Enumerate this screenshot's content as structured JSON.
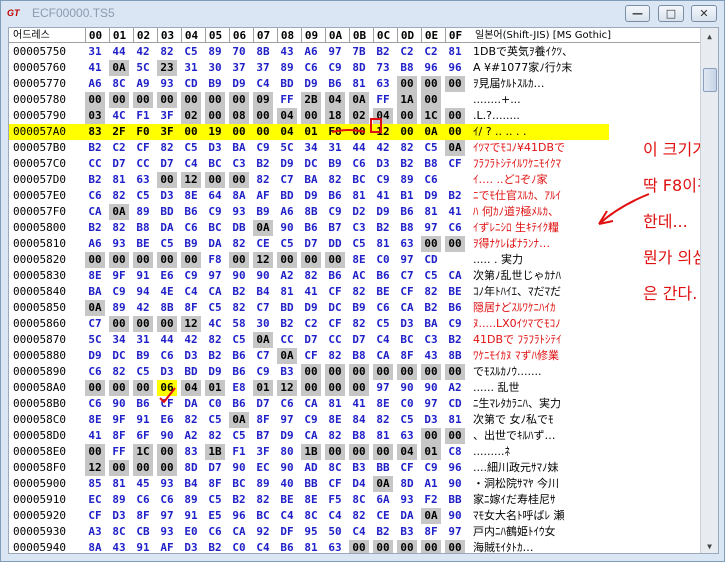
{
  "window": {
    "title": "ECF00000.TS5",
    "app_icon": "GT",
    "minimize_label": "—",
    "maximize_label": "□",
    "close_label": "✕"
  },
  "header": {
    "address_label": "어드레스",
    "columns": [
      "00",
      "01",
      "02",
      "03",
      "04",
      "05",
      "06",
      "07",
      "08",
      "09",
      "0A",
      "0B",
      "0C",
      "0D",
      "0E",
      "0F"
    ],
    "text_label": "일본어(Shift-JIS) [MS Gothic]"
  },
  "rows": [
    {
      "addr": "00005750",
      "bytes": [
        "31",
        "44",
        "42",
        "82",
        "C5",
        "89",
        "70",
        "8B",
        "43",
        "A6",
        "97",
        "7B",
        "B2",
        "C2",
        "C2",
        "81"
      ],
      "text": "1DBで英気ｦ養ｲｸﾂ、"
    },
    {
      "addr": "00005760",
      "bytes": [
        "41",
        "0A",
        "5C",
        "23",
        "31",
        "30",
        "37",
        "37",
        "89",
        "C6",
        "C9",
        "8D",
        "73",
        "B8",
        "96",
        "96"
      ],
      "text": "A ¥#1077家ﾉ行ｸ末"
    },
    {
      "addr": "00005770",
      "bytes": [
        "A6",
        "8C",
        "A9",
        "93",
        "CD",
        "B9",
        "D9",
        "C4",
        "BD",
        "D9",
        "B6",
        "81",
        "63",
        "00",
        "00",
        "00"
      ],
      "text": "ｦ見届ｹﾙﾄｽﾙｶ…"
    },
    {
      "addr": "00005780",
      "bytes": [
        "00",
        "00",
        "00",
        "00",
        "00",
        "00",
        "00",
        "09",
        "FF",
        "2B",
        "04",
        "0A",
        "FF",
        "1A",
        "00"
      ],
      "text": "........+..."
    },
    {
      "addr": "00005790",
      "bytes": [
        "03",
        "4C",
        "F1",
        "3F",
        "02",
        "00",
        "08",
        "00",
        "04",
        "00",
        "18",
        "02",
        "04",
        "00",
        "1C",
        "00"
      ],
      "text": ".L.?........"
    },
    {
      "addr": "000057A0",
      "bytes": [
        "83",
        "2F",
        "F0",
        "3F",
        "00",
        "19",
        "00",
        "00",
        "04",
        "01",
        "F8",
        "00",
        "12",
        "00",
        "0A",
        "00"
      ],
      "text": "ｲ/ ? .. .. . ."
    },
    {
      "addr": "000057B0",
      "bytes": [
        "B2",
        "C2",
        "CF",
        "82",
        "C5",
        "D3",
        "BA",
        "C9",
        "5C",
        "34",
        "31",
        "44",
        "42",
        "82",
        "C5",
        "0A"
      ],
      "text": "ｲﾂﾏでﾓｺﾉ¥41DBで"
    },
    {
      "addr": "000057C0",
      "bytes": [
        "CC",
        "D7",
        "CC",
        "D7",
        "C4",
        "BC",
        "C3",
        "B2",
        "D9",
        "DC",
        "B9",
        "C6",
        "D3",
        "B2",
        "B8",
        "CF"
      ],
      "text": "ﾌﾗﾌﾗﾄｼﾃｲﾙﾜｹﾆﾓｲｸﾏ"
    },
    {
      "addr": "000057D0",
      "bytes": [
        "B2",
        "81",
        "63",
        "00",
        "12",
        "00",
        "00",
        "82",
        "C7",
        "BA",
        "82",
        "BC",
        "C9",
        "89",
        "C6"
      ],
      "text": "ｲ…. ..どｺぞﾉ家"
    },
    {
      "addr": "000057E0",
      "bytes": [
        "C6",
        "82",
        "C5",
        "D3",
        "8E",
        "64",
        "8A",
        "AF",
        "BD",
        "D9",
        "B6",
        "81",
        "41",
        "B1",
        "D9",
        "B2"
      ],
      "text": "ﾆでﾓ仕官ｽﾙｶ、ｱﾙｲ"
    },
    {
      "addr": "000057F0",
      "bytes": [
        "CA",
        "0A",
        "89",
        "BD",
        "B6",
        "C9",
        "93",
        "B9",
        "A6",
        "8B",
        "C9",
        "D2",
        "D9",
        "B6",
        "81",
        "41"
      ],
      "text": "ﾊ 何ｶﾉ道ｦ極ﾒﾙｶ、"
    },
    {
      "addr": "00005800",
      "bytes": [
        "B2",
        "82",
        "B8",
        "DA",
        "C6",
        "BC",
        "DB",
        "0A",
        "90",
        "B6",
        "B7",
        "C3",
        "B2",
        "B8",
        "97",
        "C6"
      ],
      "text": "ｲずﾚﾆｼﾛ 生ｷﾃｲｸ糧"
    },
    {
      "addr": "00005810",
      "bytes": [
        "A6",
        "93",
        "BE",
        "C5",
        "B9",
        "DA",
        "82",
        "CE",
        "C5",
        "D7",
        "DD",
        "C5",
        "81",
        "63",
        "00",
        "00"
      ],
      "text": "ｦ得ﾅｹﾚばﾅﾗﾝﾅ…"
    },
    {
      "addr": "00005820",
      "bytes": [
        "00",
        "00",
        "00",
        "00",
        "00",
        "F8",
        "00",
        "12",
        "00",
        "00",
        "00",
        "8E",
        "C0",
        "97",
        "CD"
      ],
      "text": "..... . 実力"
    },
    {
      "addr": "00005830",
      "bytes": [
        "8E",
        "9F",
        "91",
        "E6",
        "C9",
        "97",
        "90",
        "90",
        "A2",
        "82",
        "B6",
        "AC",
        "B6",
        "C7",
        "C5",
        "CA"
      ],
      "text": "次第ﾉ乱世じゃｶﾅﾊ"
    },
    {
      "addr": "00005840",
      "bytes": [
        "BA",
        "C9",
        "94",
        "4E",
        "C4",
        "CA",
        "B2",
        "B4",
        "81",
        "41",
        "CF",
        "82",
        "BE",
        "CF",
        "82",
        "BE"
      ],
      "text": "ｺﾉ年ﾄﾊｲｴ、ﾏだﾏだ"
    },
    {
      "addr": "00005850",
      "bytes": [
        "0A",
        "89",
        "42",
        "8B",
        "8F",
        "C5",
        "82",
        "C7",
        "BD",
        "D9",
        "DC",
        "B9",
        "C6",
        "CA",
        "B2",
        "B6"
      ],
      "text": " 隠居ﾅどｽﾙﾜｹﾆﾊｲｶ"
    },
    {
      "addr": "00005860",
      "bytes": [
        "C7",
        "00",
        "00",
        "00",
        "12",
        "4C",
        "58",
        "30",
        "B2",
        "C2",
        "CF",
        "82",
        "C5",
        "D3",
        "BA",
        "C9"
      ],
      "text": "ﾇ.....LX0ｲﾂﾏでﾓｺﾉ"
    },
    {
      "addr": "00005870",
      "bytes": [
        "5C",
        "34",
        "31",
        "44",
        "42",
        "82",
        "C5",
        "0A",
        "CC",
        "D7",
        "CC",
        "D7",
        "C4",
        "BC",
        "C3",
        "B2"
      ],
      "text": "41DBで ﾌﾗﾌﾗﾄｼﾃｲ"
    },
    {
      "addr": "00005880",
      "bytes": [
        "D9",
        "DC",
        "B9",
        "C6",
        "D3",
        "B2",
        "B6",
        "C7",
        "0A",
        "CF",
        "82",
        "B8",
        "CA",
        "8F",
        "43",
        "8B"
      ],
      "text": "ﾜｹﾆﾓｲｶﾇ ﾏずﾊ修業"
    },
    {
      "addr": "00005890",
      "bytes": [
        "C6",
        "82",
        "C5",
        "D3",
        "BD",
        "D9",
        "B6",
        "C9",
        "B3",
        "00",
        "00",
        "00",
        "00",
        "00",
        "00",
        "00"
      ],
      "text": "でﾓｽﾙｶﾉｳ......."
    },
    {
      "addr": "000058A0",
      "bytes": [
        "00",
        "00",
        "00",
        "06",
        "04",
        "01",
        "E8",
        "01",
        "12",
        "00",
        "00",
        "00",
        "97",
        "90",
        "90",
        "A2"
      ],
      "text": "...... 乱世"
    },
    {
      "addr": "000058B0",
      "bytes": [
        "C6",
        "90",
        "B6",
        "CF",
        "DA",
        "C0",
        "B6",
        "D7",
        "C6",
        "CA",
        "81",
        "41",
        "8E",
        "C0",
        "97",
        "CD"
      ],
      "text": "ﾆ生ﾏﾚﾀｶﾗﾆﾊ、実力"
    },
    {
      "addr": "000058C0",
      "bytes": [
        "8E",
        "9F",
        "91",
        "E6",
        "82",
        "C5",
        "0A",
        "8F",
        "97",
        "C9",
        "8E",
        "84",
        "82",
        "C5",
        "D3",
        "81"
      ],
      "text": "次第で 女ﾉ私でﾓ"
    },
    {
      "addr": "000058D0",
      "bytes": [
        "41",
        "8F",
        "6F",
        "90",
        "A2",
        "82",
        "C5",
        "B7",
        "D9",
        "CA",
        "82",
        "B8",
        "81",
        "63",
        "00",
        "00"
      ],
      "text": "、出世でｷﾙﾊず…"
    },
    {
      "addr": "000058E0",
      "bytes": [
        "00",
        "FF",
        "1C",
        "00",
        "83",
        "1B",
        "F1",
        "3F",
        "80",
        "1B",
        "00",
        "00",
        "00",
        "04",
        "01",
        "C8"
      ],
      "text": ".........ﾈ"
    },
    {
      "addr": "000058F0",
      "bytes": [
        "12",
        "00",
        "00",
        "00",
        "8D",
        "D7",
        "90",
        "EC",
        "90",
        "AD",
        "8C",
        "B3",
        "BB",
        "CF",
        "C9",
        "96"
      ],
      "text": "....細川政元ｻﾏﾉ妹"
    },
    {
      "addr": "00005900",
      "bytes": [
        "85",
        "81",
        "45",
        "93",
        "B4",
        "8F",
        "BC",
        "89",
        "40",
        "BB",
        "CF",
        "D4",
        "0A",
        "8D",
        "A1",
        "90"
      ],
      "text": "・洞松院ｻﾏﾔ 今川"
    },
    {
      "addr": "00005910",
      "bytes": [
        "EC",
        "89",
        "C6",
        "C6",
        "89",
        "C5",
        "B2",
        "82",
        "BE",
        "8E",
        "F5",
        "8C",
        "6A",
        "93",
        "F2",
        "BB"
      ],
      "text": "家ﾆ嫁ｲだ寿桂尼ｻ"
    },
    {
      "addr": "00005920",
      "bytes": [
        "CF",
        "D3",
        "8F",
        "97",
        "91",
        "E5",
        "96",
        "BC",
        "C4",
        "8C",
        "C4",
        "82",
        "CE",
        "DA",
        "0A",
        "90"
      ],
      "text": "ﾏﾓ女大名ﾄ呼ばﾚ 瀬"
    },
    {
      "addr": "00005930",
      "bytes": [
        "A3",
        "8C",
        "CB",
        "93",
        "E0",
        "C6",
        "CA",
        "92",
        "DF",
        "95",
        "50",
        "C4",
        "B2",
        "B3",
        "8F",
        "97"
      ],
      "text": "戸内ﾆﾊ鶴姫ﾄｲｳ女"
    },
    {
      "addr": "00005940",
      "bytes": [
        "8A",
        "43",
        "91",
        "AF",
        "D3",
        "B2",
        "C0",
        "C4",
        "B6",
        "81",
        "63",
        "00",
        "00",
        "00",
        "00",
        "00"
      ],
      "text": "海賊ﾓｲﾀﾄｶ…"
    }
  ],
  "annotation": {
    "lines": [
      "이 크기가",
      "딱 F8이긴",
      "한데...",
      "뭔가 의심",
      "은 간다."
    ]
  },
  "colors": {
    "highlight": "#ffff00",
    "annotation": "#e01010",
    "byte_blue": "#2020c8"
  }
}
